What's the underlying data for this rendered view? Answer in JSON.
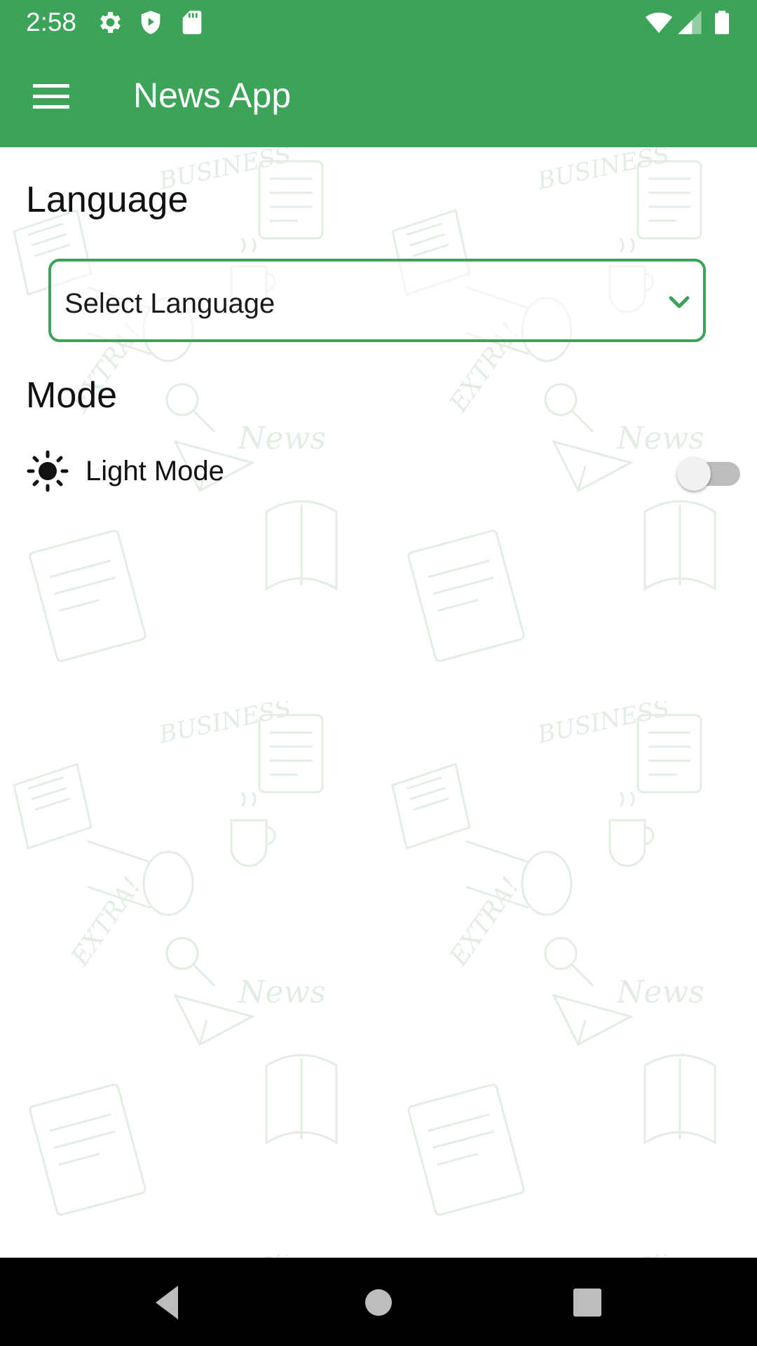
{
  "status_bar": {
    "time": "2:58",
    "left_icons": [
      "settings-icon",
      "shield-icon",
      "sd-card-icon"
    ],
    "right_icons": [
      "wifi-icon",
      "cell-signal-icon",
      "battery-icon"
    ],
    "background": "#3BA458"
  },
  "app_bar": {
    "title": "News App",
    "menu_icon": "hamburger-menu-icon",
    "background": "#3BA458"
  },
  "settings": {
    "language_title": "Language",
    "language_select": {
      "value": "Select Language",
      "icon": "chevron-down-icon",
      "border_color": "#3BA458"
    },
    "mode_title": "Mode",
    "mode_option": {
      "label": "Light Mode",
      "icon": "sun-icon",
      "toggle_on": false
    }
  },
  "nav_bar": {
    "buttons": [
      "back-icon",
      "home-icon",
      "recents-icon"
    ]
  },
  "colors": {
    "accent": "#3BA458",
    "pattern": "#2e7d32"
  }
}
